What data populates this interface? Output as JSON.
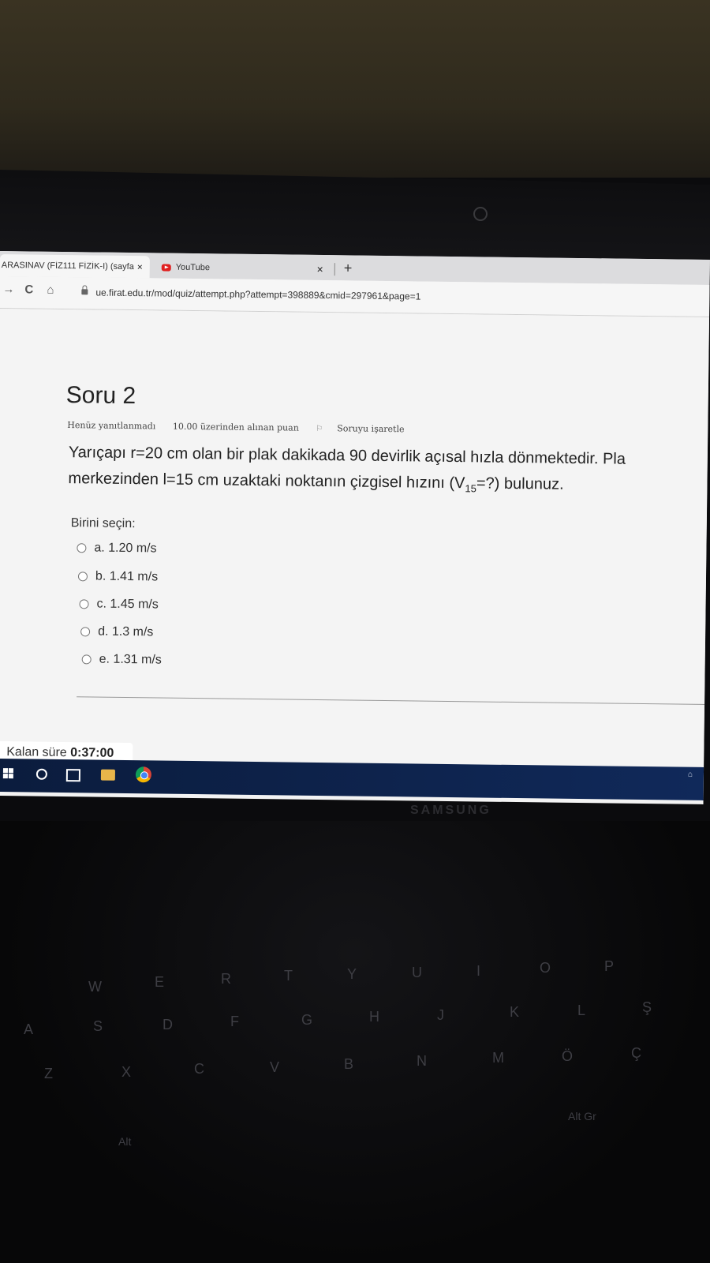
{
  "browser": {
    "tabs": [
      {
        "title": "ARASINAV (FİZ111 FİZİK-I) (sayfa",
        "close": "×"
      },
      {
        "title": "YouTube",
        "close": "×"
      }
    ],
    "new_tab": "+",
    "nav": {
      "back": "→",
      "reload": "C",
      "home": "⌂"
    },
    "url": "ue.firat.edu.tr/mod/quiz/attempt.php?attempt=398889&cmid=297961&page=1"
  },
  "question": {
    "title": "Soru 2",
    "status": "Henüz yanıtlanmadı",
    "points": "10.00 üzerinden alınan puan",
    "flag": "Soruyu işaretle",
    "line1": "Yarıçapı r=20 cm olan bir plak dakikada 90 devirlik açısal hızla dönmektedir. Pla",
    "line2_a": "merkezinden l=15 cm  uzaktaki noktanın çizgisel hızını (V",
    "line2_sub": "15",
    "line2_b": "=?) bulunuz.",
    "prompt": "Birini seçin:",
    "options": [
      {
        "label": "a. 1.20 m/s"
      },
      {
        "label": "b. 1.41 m/s"
      },
      {
        "label": "c. 1.45 m/s"
      },
      {
        "label": "d. 1.3 m/s"
      },
      {
        "label": "e. 1.31 m/s"
      }
    ]
  },
  "timer": {
    "label": "Kalan süre",
    "value": "0:37:00"
  },
  "device": {
    "brand": "SAMSUNG"
  },
  "keyboard": {
    "keys": [
      "W",
      "E",
      "R",
      "T",
      "Y",
      "U",
      "I",
      "O",
      "P",
      "A",
      "S",
      "D",
      "F",
      "G",
      "H",
      "J",
      "K",
      "L",
      "Ş",
      "Z",
      "X",
      "C",
      "V",
      "B",
      "N",
      "M",
      "Ö",
      "Ç",
      "Alt",
      "Alt Gr"
    ]
  }
}
